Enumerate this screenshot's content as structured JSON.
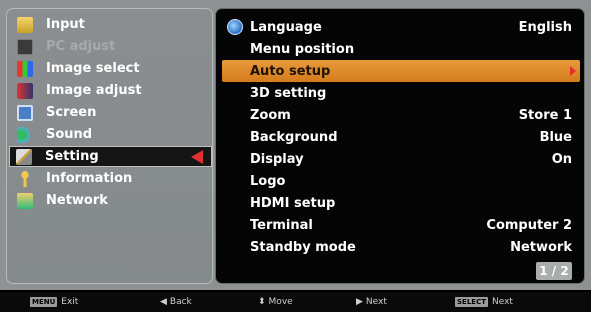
{
  "left_menu": {
    "items": [
      {
        "label": "Input",
        "icon": "input-icon",
        "state": "normal"
      },
      {
        "label": "PC adjust",
        "icon": "pc-adjust-icon",
        "state": "disabled"
      },
      {
        "label": "Image select",
        "icon": "image-select-icon",
        "state": "normal"
      },
      {
        "label": "Image adjust",
        "icon": "image-adjust-icon",
        "state": "normal"
      },
      {
        "label": "Screen",
        "icon": "screen-icon",
        "state": "normal"
      },
      {
        "label": "Sound",
        "icon": "sound-icon",
        "state": "normal"
      },
      {
        "label": "Setting",
        "icon": "setting-icon",
        "state": "selected"
      },
      {
        "label": "Information",
        "icon": "information-icon",
        "state": "normal"
      },
      {
        "label": "Network",
        "icon": "network-icon",
        "state": "normal"
      }
    ]
  },
  "right_menu": {
    "items": [
      {
        "label": "Language",
        "value": "English"
      },
      {
        "label": "Menu position",
        "value": ""
      },
      {
        "label": "Auto setup",
        "value": ""
      },
      {
        "label": "3D setting",
        "value": ""
      },
      {
        "label": "Zoom",
        "value": "Store 1"
      },
      {
        "label": "Background",
        "value": "Blue"
      },
      {
        "label": "Display",
        "value": "On"
      },
      {
        "label": "Logo",
        "value": ""
      },
      {
        "label": "HDMI setup",
        "value": ""
      },
      {
        "label": "Terminal",
        "value": "Computer 2"
      },
      {
        "label": "Standby mode",
        "value": "Network"
      }
    ],
    "page": "1 / 2"
  },
  "hints": {
    "exit_key": "MENU",
    "exit": "Exit",
    "back": "Back",
    "move": "Move",
    "next": "Next",
    "select_key": "SELECT",
    "select_next": "Next"
  },
  "colors": {
    "highlight": "#e08a2a",
    "selected_bg": "#151515",
    "arrow": "#e03030"
  }
}
